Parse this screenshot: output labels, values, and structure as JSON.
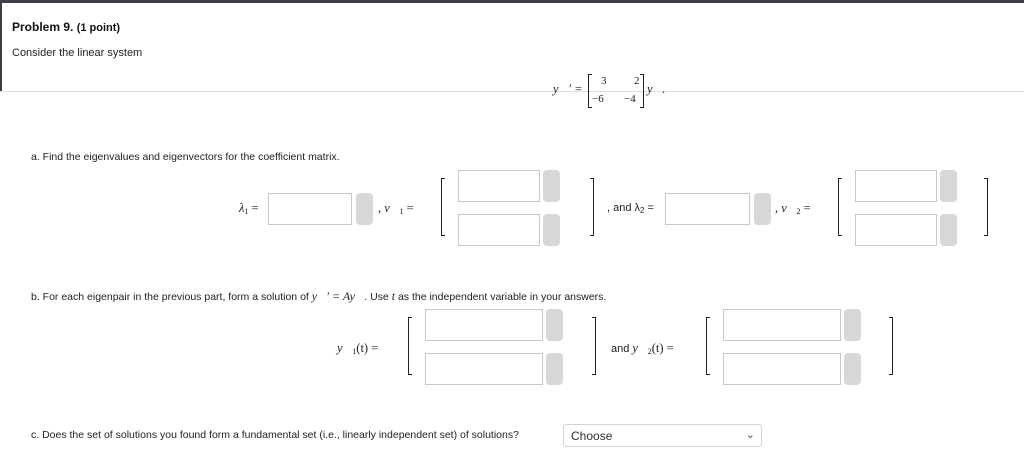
{
  "problem": {
    "title": "Problem 9.",
    "points": "(1 point)",
    "intro": "Consider the linear system"
  },
  "system": {
    "lhs": "y⃗′ =",
    "matrix": [
      [
        "3",
        "2"
      ],
      [
        "−6",
        "−4"
      ]
    ],
    "rhs": "y⃗."
  },
  "part_a": {
    "prompt": "a. Find the eigenvalues and eigenvectors for the coefficient matrix.",
    "lambda1_label": "λ",
    "lambda1_sub": "1",
    "eq": "=",
    "v1_label": ", v⃗",
    "v1_sub": "1",
    "and_lambda2_text": ", and λ",
    "lambda2_sub": "2",
    "v2_label": ", v⃗",
    "v2_sub": "2"
  },
  "part_b": {
    "prompt_start": "b. For each eigenpair in the previous part, form a solution of ",
    "prompt_eq": "y⃗′ = Ay⃗",
    "prompt_mid": ". Use ",
    "prompt_t": "t",
    "prompt_end": " as the independent variable in your answers.",
    "y1_label": "y⃗",
    "y1_sub": "1",
    "y1_arg": "(t) =",
    "and_text": "and ",
    "y2_label": "y⃗",
    "y2_sub": "2",
    "y2_arg": "(t) ="
  },
  "part_c": {
    "prompt": "c. Does the set of solutions you found form a fundamental set (i.e., linearly independent set) of solutions?",
    "select_value": "Choose"
  },
  "icons": {
    "chevron": "chevron-down-icon"
  },
  "colors": {
    "topbar": "#3c4046",
    "input_border": "#c8c8c8",
    "pill": "#d8d8d8"
  }
}
